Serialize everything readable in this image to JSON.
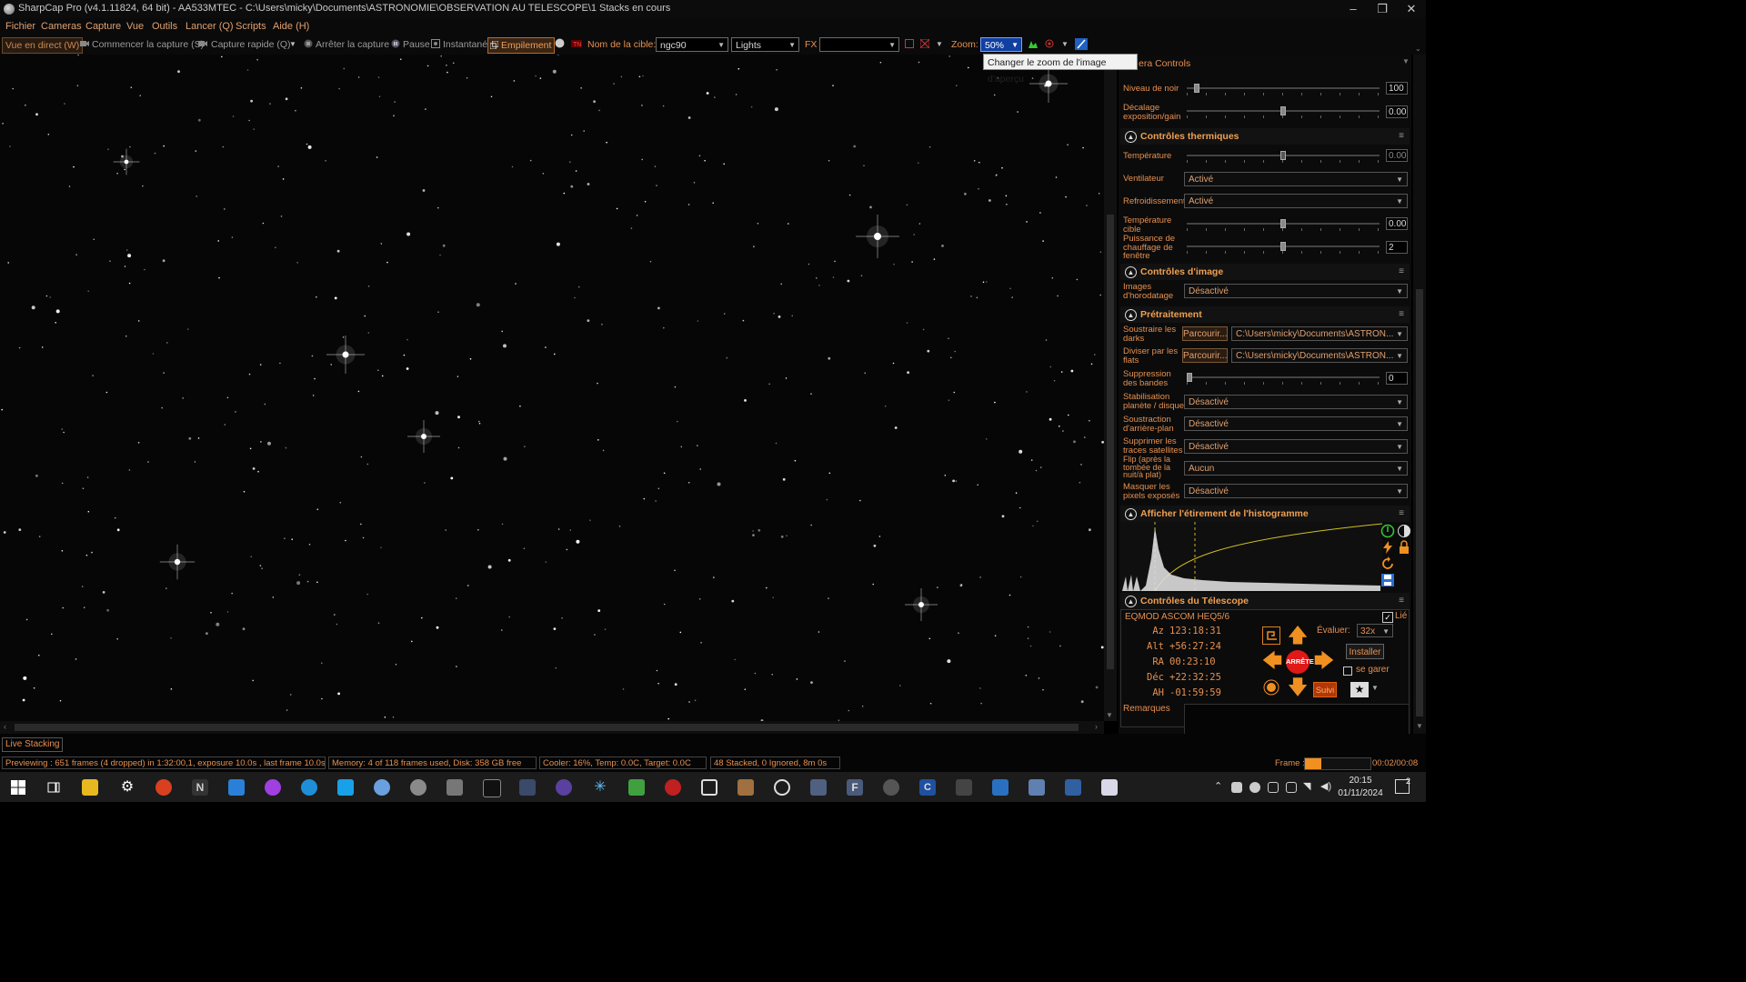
{
  "window": {
    "title": "SharpCap Pro (v4.1.11824, 64 bit) - AA533MTEC - C:\\Users\\micky\\Documents\\ASTRONOMIE\\OBSERVATION AU TELESCOPE\\1 Stacks en cours",
    "min": "–",
    "max": "❐",
    "close": "✕"
  },
  "menu": [
    "Fichier",
    "Cameras",
    "Capture",
    "Vue",
    "Outils",
    "Lancer (Q)",
    "Scripts",
    "Aide (H)"
  ],
  "toolbar": {
    "live_view": "Vue en direct (W)",
    "start_capture": "Commencer la capture (S)",
    "quick_capture": "Capture rapide (Q)",
    "stop_capture": "Arrêter la capture",
    "pause": "Pause",
    "snapshot": "Instantané",
    "stacking": "Empilement",
    "target_label": "Nom de la cible:",
    "target_value": "ngc90",
    "frame_type": "Lights",
    "fx_label": "FX",
    "fx_value": "",
    "zoom_label": "Zoom:",
    "zoom_value": "50%",
    "tooltip": "Changer le zoom de l'image d'aperçu"
  },
  "panel": {
    "header_partial": "era Controls",
    "black_level": {
      "label": "Niveau de noir",
      "value": "100"
    },
    "exposure_gain_offset": {
      "label": "Décalage exposition/gain",
      "value": "0.00"
    },
    "thermal": {
      "title": "Contrôles thermiques",
      "temperature": {
        "label": "Température",
        "value": "0.00"
      },
      "fan": {
        "label": "Ventilateur",
        "value": "Activé"
      },
      "cooling": {
        "label": "Refroidissement",
        "value": "Activé"
      },
      "target_temp": {
        "label": "Température cible",
        "value": "0.00"
      },
      "heater": {
        "label": "Puissance de chauffage de fenêtre",
        "value": "2"
      }
    },
    "image_controls": {
      "title": "Contrôles d'image",
      "timestamp": {
        "label": "Images d'horodatage",
        "value": "Désactivé"
      }
    },
    "preprocessing": {
      "title": "Prétraitement",
      "darks": {
        "label": "Soustraire les darks",
        "button": "Parcourir...",
        "path": "C:\\Users\\micky\\Documents\\ASTRON..."
      },
      "flats": {
        "label": "Diviser par les flats",
        "button": "Parcourir...",
        "path": "C:\\Users\\micky\\Documents\\ASTRON..."
      },
      "banding": {
        "label": "Suppression des bandes",
        "value": "0"
      },
      "planet_stab": {
        "label": "Stabilisation planète / disque",
        "value": "Désactivé"
      },
      "bg_sub": {
        "label": "Soustraction d'arrière-plan",
        "value": "Désactivé"
      },
      "sat_trails": {
        "label": "Supprimer les traces satellites",
        "value": "Désactivé"
      },
      "flip": {
        "label": "Flip (après la tombée de la nuit/à plat)",
        "value": "Aucun"
      },
      "mask_pixels": {
        "label": "Masquer les pixels exposés",
        "value": "Désactivé"
      }
    },
    "histogram": {
      "title": "Afficher l'étirement de l'histogramme"
    },
    "telescope": {
      "title": "Contrôles du Télescope",
      "mount": "EQMOD ASCOM HEQ5/6",
      "linked": "Lié",
      "coords": [
        {
          "label": "Az",
          "value": "123:18:31"
        },
        {
          "label": "Alt",
          "value": "+56:27:24"
        },
        {
          "label": "RA",
          "value": "00:23:10"
        },
        {
          "label": "Déc",
          "value": "+22:32:25"
        },
        {
          "label": "AH",
          "value": "-01:59:59"
        }
      ],
      "stop": "ARRÊTE",
      "rate_label": "Évaluer:",
      "rate_value": "32x",
      "install": "Installer",
      "park": "se garer",
      "track": "Suivi",
      "remarks": "Remarques"
    }
  },
  "status": {
    "live_stacking": "Live Stacking",
    "previewing": "Previewing : 651 frames (4 dropped) in 1:32:00,1, exposure 10.0s , last frame 10.0s",
    "memory": "Memory: 4 of 118 frames used, Disk: 358 GB free",
    "cooler": "Cooler: 16%, Temp: 0.0C, Target: 0.0C",
    "stacked": "48 Stacked, 0 Ignored, 8m 0s",
    "frame_label": "Frame :",
    "frame_time": "00:02/00:08"
  },
  "taskbar": {
    "time": "20:15",
    "date": "01/11/2024",
    "notifications": "2"
  },
  "colors": {
    "accent": "#e69050",
    "bg": "#000000"
  }
}
